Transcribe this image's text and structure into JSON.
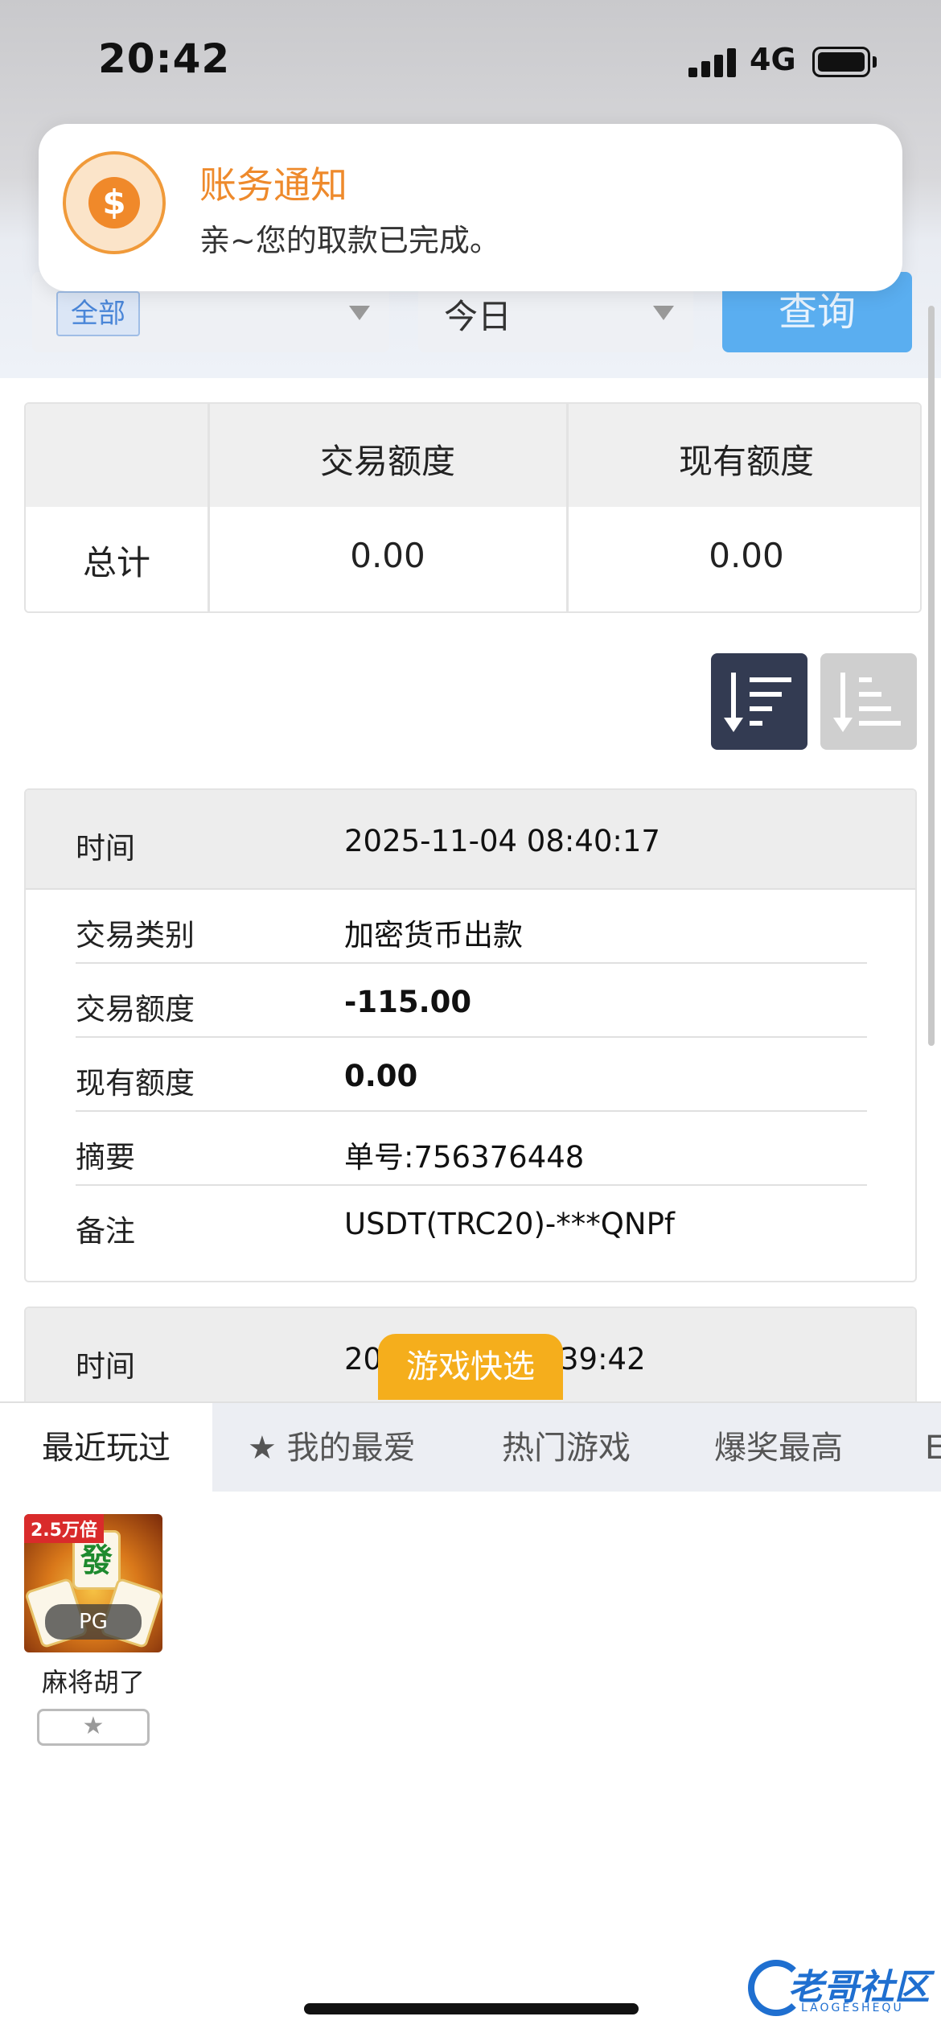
{
  "status_bar": {
    "time": "20:42",
    "network": "4G"
  },
  "notification": {
    "title": "账务通知",
    "body": "亲~您的取款已完成。",
    "icon": "dollar-coin-icon",
    "accent_color": "#ee8a2c"
  },
  "filters": {
    "category_selected": "全部",
    "date_selected": "今日",
    "query_label": "查询"
  },
  "summary_table": {
    "columns": [
      "交易额度",
      "现有额度"
    ],
    "row_label": "总计",
    "values": [
      "0.00",
      "0.00"
    ]
  },
  "sort_buttons": {
    "desc_icon": "sort-descending-icon",
    "asc_icon": "sort-ascending-icon"
  },
  "transactions": [
    {
      "time_label": "时间",
      "time": "2025-11-04 08:40:17",
      "fields": [
        {
          "label": "交易类别",
          "value": "加密货币出款"
        },
        {
          "label": "交易额度",
          "value": "-115.00"
        },
        {
          "label": "现有额度",
          "value": "0.00"
        },
        {
          "label": "摘要",
          "value": "单号:756376448"
        },
        {
          "label": "备注",
          "value": "USDT(TRC20)-***QNPf"
        }
      ]
    },
    {
      "time_label": "时间",
      "time_visible_left": "20",
      "time_visible_right": "39:42"
    }
  ],
  "game_panel": {
    "quick_tag": "游戏快选",
    "tabs": [
      "最近玩过",
      "★ 我的最爱",
      "热门游戏",
      "爆奖最高",
      "E"
    ],
    "active_tab": 0,
    "games": [
      {
        "name": "麻将胡了",
        "badge": "2.5万倍",
        "provider": "PG",
        "tile_text": "發",
        "fav_icon": "★"
      }
    ]
  },
  "watermark": {
    "main": "老哥社区",
    "sub": "LAOGESHEQU"
  }
}
